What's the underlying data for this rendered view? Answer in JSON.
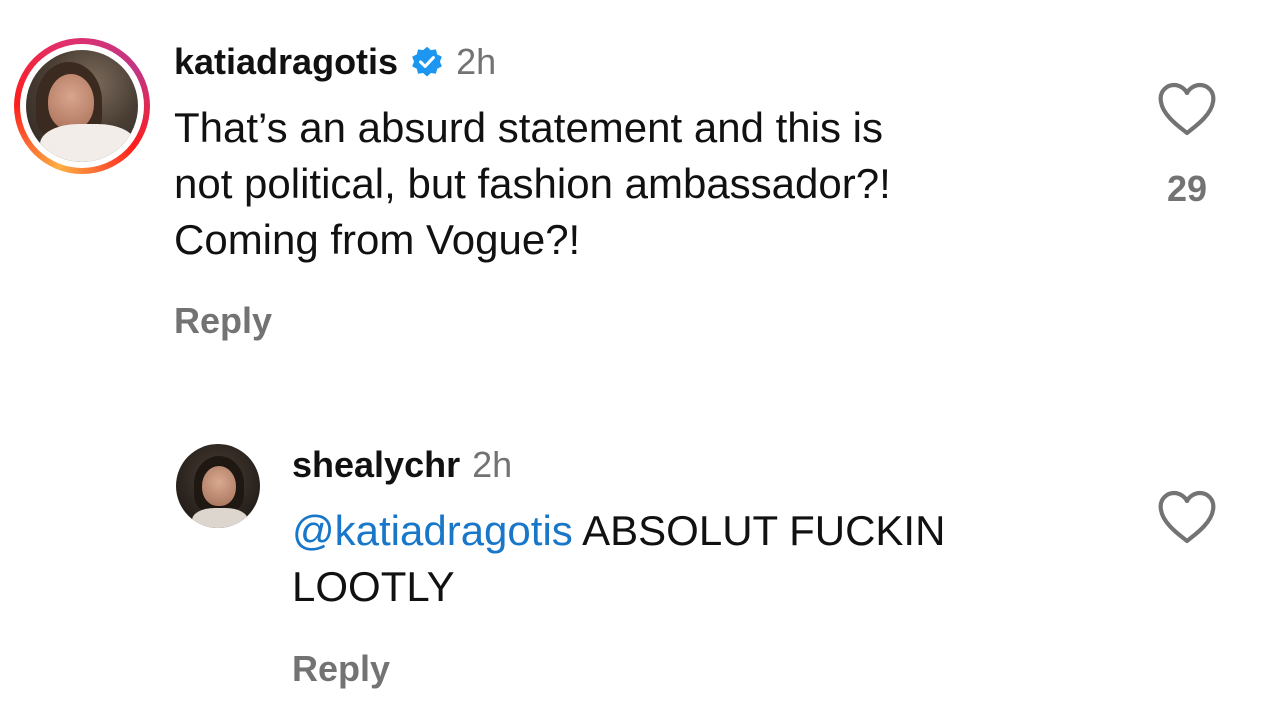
{
  "comments": [
    {
      "username": "katiadragotis",
      "verified": true,
      "time": "2h",
      "text": "That’s an absurd statement and this is\nnot political, but fashion ambassador?!\nComing from Vogue?!",
      "likes": "29",
      "reply_label": "Reply"
    },
    {
      "username": "shealychr",
      "verified": false,
      "time": "2h",
      "mention": "@katiadragotis",
      "text": " ABSOLUT FUCKIN\nLOOTLY",
      "reply_label": "Reply"
    }
  ],
  "colors": {
    "secondary_text": "#737373",
    "mention": "#1877c9",
    "verified": "#1c96f0"
  },
  "icons": {
    "like": "heart-outline-icon",
    "verified": "verified-badge-icon"
  }
}
